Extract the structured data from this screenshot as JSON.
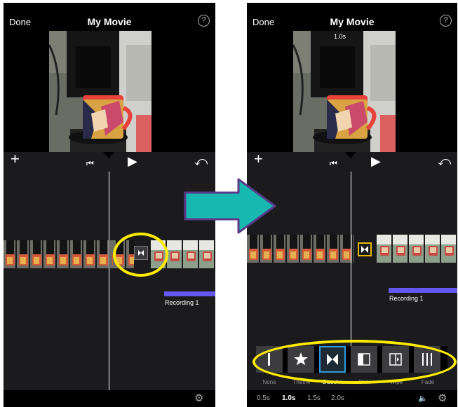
{
  "left_screen": {
    "header": {
      "done_label": "Done",
      "title": "My Movie",
      "help_label": "?"
    },
    "controls": {
      "add_icon": "+",
      "skip_back_icon": "⏮",
      "play_icon": "▶",
      "undo_icon": "⤺"
    },
    "recording_label": "Recording 1",
    "settings_icon": "⚙"
  },
  "right_screen": {
    "header": {
      "done_label": "Done",
      "title": "My Movie",
      "help_label": "?"
    },
    "preview_overlay": "1.0s",
    "controls": {
      "add_icon": "+",
      "skip_back_icon": "⏮",
      "play_icon": "▶",
      "undo_icon": "⤺"
    },
    "recording_label": "Recording 1",
    "transition_options": [
      {
        "label": "None",
        "selected": false
      },
      {
        "label": "Theme",
        "selected": false
      },
      {
        "label": "Dissolve",
        "selected": true
      },
      {
        "label": "Slide",
        "selected": false
      },
      {
        "label": "Wipe",
        "selected": false
      },
      {
        "label": "Fade",
        "selected": false
      }
    ],
    "durations": [
      {
        "label": "0.5s",
        "selected": false
      },
      {
        "label": "1.0s",
        "selected": true
      },
      {
        "label": "1.5s",
        "selected": false
      },
      {
        "label": "2.0s",
        "selected": false
      }
    ],
    "mute_icon": "🔈",
    "settings_icon": "⚙"
  },
  "colors": {
    "highlight": "#ffeb00",
    "arrow": "#17b8b0",
    "arrow_outline": "#5b3a8a",
    "recording": "#6458f0",
    "selection": "#2f9bdc",
    "transition_selected": "#e6b800"
  }
}
